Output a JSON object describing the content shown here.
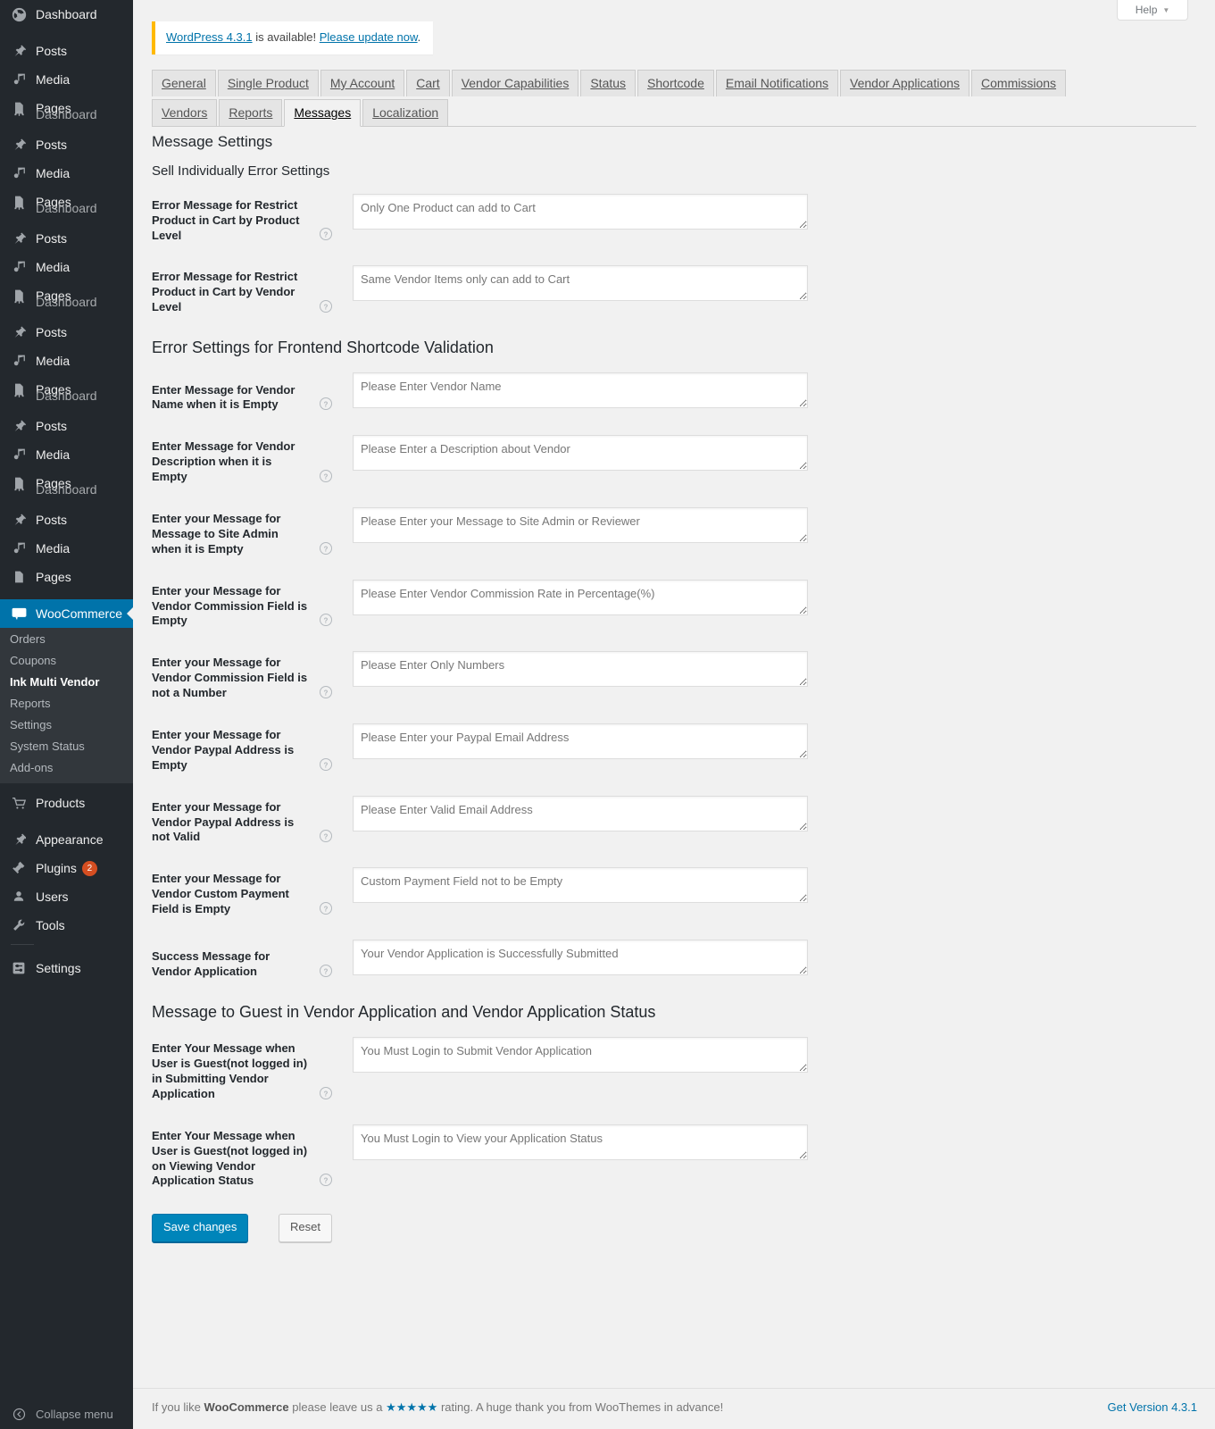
{
  "sidebar": {
    "blocks": [
      {
        "items": [
          {
            "label": "Dashboard",
            "icon": "dashboard-icon"
          },
          {
            "gap": true
          },
          {
            "label": "Posts",
            "icon": "pin-icon"
          },
          {
            "label": "Media",
            "icon": "media-icon"
          },
          {
            "label": "Pages",
            "icon": "pages-icon",
            "ghost": "Dashboard"
          }
        ]
      },
      {
        "items": [
          {
            "gap": true
          },
          {
            "label": "Posts",
            "icon": "pin-icon"
          },
          {
            "label": "Media",
            "icon": "media-icon"
          },
          {
            "label": "Pages",
            "icon": "pages-icon",
            "ghost": "Dashboard"
          }
        ]
      }
    ],
    "woocommerce": {
      "label": "WooCommerce",
      "icon": "woo-icon",
      "submenu": [
        {
          "label": "Orders"
        },
        {
          "label": "Coupons"
        },
        {
          "label": "Ink Multi Vendor",
          "current": true
        },
        {
          "label": "Reports"
        },
        {
          "label": "Settings"
        },
        {
          "label": "System Status"
        },
        {
          "label": "Add-ons"
        }
      ]
    },
    "products": {
      "label": "Products",
      "icon": "cart-icon"
    },
    "bottom_items": [
      {
        "label": "Appearance",
        "icon": "appearance-icon"
      },
      {
        "label": "Plugins",
        "icon": "plugins-icon",
        "badge": "2"
      },
      {
        "label": "Users",
        "icon": "users-icon"
      },
      {
        "label": "Tools",
        "icon": "tools-icon"
      },
      {
        "separator": true
      },
      {
        "label": "Settings",
        "icon": "settings-icon"
      }
    ],
    "collapse": {
      "label": "Collapse menu",
      "icon": "collapse-icon"
    }
  },
  "help_tab": {
    "label": "Help",
    "caret": "▼"
  },
  "update_nag": {
    "link1": "WordPress 4.3.1",
    "mid": " is available! ",
    "link2": "Please update now",
    "end": "."
  },
  "tabs_row1": [
    {
      "label": "General"
    },
    {
      "label": "Single Product"
    },
    {
      "label": "My Account"
    },
    {
      "label": "Cart"
    },
    {
      "label": "Vendor Capabilities"
    },
    {
      "label": "Status"
    },
    {
      "label": "Shortcode"
    },
    {
      "label": "Email Notifications"
    },
    {
      "label": "Vendor Applications"
    },
    {
      "label": "Commissions"
    }
  ],
  "tabs_row2": [
    {
      "label": "Vendors"
    },
    {
      "label": "Reports"
    },
    {
      "label": "Messages",
      "active": true
    },
    {
      "label": "Localization"
    }
  ],
  "main": {
    "title": "Message Settings",
    "section1_heading": "Sell Individually Error Settings",
    "section1_fields": [
      {
        "label": "Error Message for Restrict Product in Cart by Product Level",
        "value": "Only One Product can add to Cart",
        "tip": "help-icon"
      },
      {
        "label": "Error Message for Restrict Product in Cart by Vendor Level",
        "value": "Same Vendor Items only can add to Cart",
        "tip": "help-icon"
      }
    ],
    "section2_heading": "Error Settings for Frontend Shortcode Validation",
    "section2_fields": [
      {
        "label": "Enter Message for Vendor Name when it is Empty",
        "value": "Please Enter Vendor Name",
        "tip": "help-icon"
      },
      {
        "label": "Enter Message for Vendor Description when it is Empty",
        "value": "Please Enter a Description about Vendor",
        "tip": "help-icon"
      },
      {
        "label": "Enter your Message for Message to Site Admin when it is Empty",
        "value": "Please Enter your Message to Site Admin or Reviewer",
        "tip": "help-icon"
      },
      {
        "label": "Enter your Message for Vendor Commission Field is Empty",
        "value": "Please Enter Vendor Commission Rate in Percentage(%)",
        "tip": "help-icon"
      },
      {
        "label": "Enter your Message for Vendor Commission Field is not a Number",
        "value": "Please Enter Only Numbers",
        "tip": "help-icon"
      },
      {
        "label": "Enter your Message for Vendor Paypal Address is Empty",
        "value": "Please Enter your Paypal Email Address",
        "tip": "help-icon"
      },
      {
        "label": "Enter your Message for Vendor Paypal Address is not Valid",
        "value": "Please Enter Valid Email Address",
        "tip": "help-icon"
      },
      {
        "label": "Enter your Message for Vendor Custom Payment Field is Empty",
        "value": "Custom Payment Field not to be Empty",
        "tip": "help-icon"
      },
      {
        "label": "Success Message for Vendor Application",
        "value": "Your Vendor Application is Successfully Submitted",
        "tip": "help-icon"
      }
    ],
    "section3_heading": "Message to Guest in Vendor Application and Vendor Application Status",
    "section3_fields": [
      {
        "label": "Enter Your Message when User is Guest(not logged in) in Submitting Vendor Application",
        "value": "You Must Login to Submit Vendor Application",
        "tip": "help-icon"
      },
      {
        "label": "Enter Your Message when User is Guest(not logged in) on Viewing Vendor Application Status",
        "value": "You Must Login to View your Application Status",
        "tip": "help-icon"
      }
    ],
    "save_label": "Save changes",
    "reset_label": "Reset"
  },
  "footer": {
    "left_pre": "If you like ",
    "left_brand": "WooCommerce",
    "left_mid": " please leave us a ",
    "stars": "★★★★★",
    "left_post": " rating. A huge thank you from WooThemes in advance!",
    "right": "Get Version 4.3.1"
  },
  "colors": {
    "sidebar_bg": "#23282d",
    "submenu_bg": "#32373c",
    "accent_blue": "#0073aa",
    "primary_button": "#0085ba",
    "nag_border": "#ffb900",
    "badge": "#d54e21",
    "page_bg": "#f1f1f1"
  }
}
